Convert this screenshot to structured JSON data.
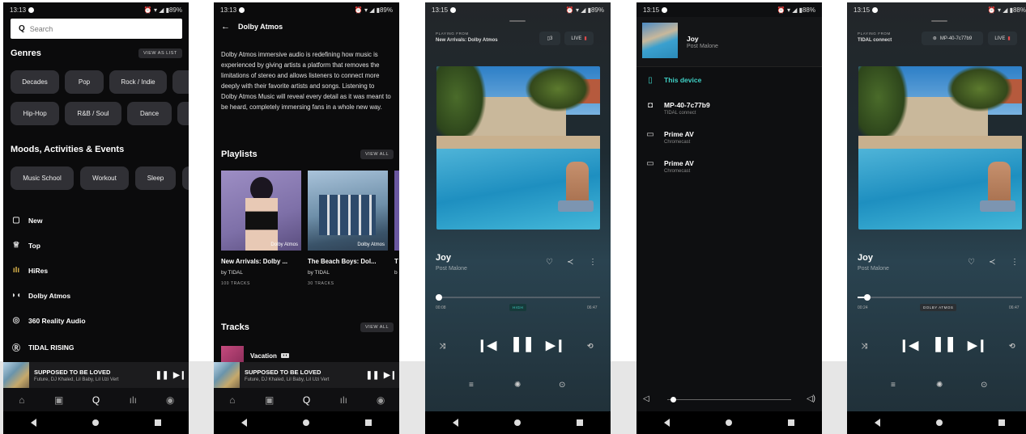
{
  "screens": {
    "search": {
      "status_time": "13:13",
      "status_icons": "⏰ ▾ ◢ ▮89%",
      "search_placeholder": "Search",
      "genres_title": "Genres",
      "view_as_list": "VIEW AS LIST",
      "genres": [
        "Decades",
        "Pop",
        "Rock / Indie",
        "Hip-Hop",
        "R&B / Soul",
        "Dance"
      ],
      "moods_title": "Moods, Activities & Events",
      "moods": [
        "Music School",
        "Workout",
        "Sleep"
      ],
      "menu": [
        {
          "label": "New",
          "icon": "calendar-icon"
        },
        {
          "label": "Top",
          "icon": "trophy-icon"
        },
        {
          "label": "HiRes",
          "icon": "waveform-icon"
        },
        {
          "label": "Dolby Atmos",
          "icon": "dolby-icon"
        },
        {
          "label": "360 Reality Audio",
          "icon": "360-icon"
        },
        {
          "label": "TIDAL RISING",
          "icon": "rising-icon"
        }
      ]
    },
    "dolby": {
      "status_time": "13:13",
      "status_icons": "⏰ ▾ ◢ ▮89%",
      "header": "Dolby Atmos",
      "description": "Dolby Atmos immersive audio is redefining how music is experienced by giving artists a platform that removes the limitations of stereo and allows listeners to connect more deeply with their favorite artists and songs. Listening to Dolby Atmos Music will reveal every detail as it was meant to be heard, completely immersing fans in a whole new way.",
      "playlists_title": "Playlists",
      "view_all": "VIEW ALL",
      "playlists": [
        {
          "title": "New Arrivals: Dolby ...",
          "by": "by TIDAL",
          "count": "100 TRACKS",
          "badge": "Dolby Atmos"
        },
        {
          "title": "The Beach Boys: Dol...",
          "by": "by TIDAL",
          "count": "30 TRACKS",
          "badge": "Dolby Atmos"
        },
        {
          "title": "T",
          "by": "b",
          "count": "",
          "badge": ""
        }
      ],
      "tracks_title": "Tracks",
      "track": "Vacation"
    },
    "mini_player": {
      "title": "SUPPOSED TO BE LOVED",
      "artists": "Future, DJ Khaled, Lil Baby, Lil Uzi Vert"
    },
    "player": {
      "status_time": "13:15",
      "status_icons": "⏰ ▾ ◢ ▮89%",
      "playing_from_label": "PLAYING FROM",
      "playing_from": "New Arrivals: Dolby Atmos",
      "queue_count": "3",
      "live": "LIVE",
      "song": "Joy",
      "artist": "Post Malone",
      "elapsed": "00:08",
      "duration": "06:47",
      "quality": "HIGH",
      "progress_fraction": 0.02
    },
    "devices": {
      "status_time": "13:15",
      "status_icons": "⏰ ▾ ◢ ▮88%",
      "song": "Joy",
      "artist": "Post Malone",
      "list": [
        {
          "name": "This device",
          "sub": "",
          "icon": "phone-icon",
          "active": true
        },
        {
          "name": "MP-40-7c77b9",
          "sub": "TIDAL connect",
          "icon": "speaker-icon",
          "active": false
        },
        {
          "name": "Prime AV",
          "sub": "Chromecast",
          "icon": "tv-icon",
          "active": false
        },
        {
          "name": "Prime AV",
          "sub": "Chromecast",
          "icon": "tv-icon",
          "active": false
        }
      ],
      "volume_fraction": 0.02
    },
    "connect": {
      "status_time": "13:15",
      "status_icons": "⏰ ▾ ◢ ▮88%",
      "playing_from_label": "PLAYING FROM",
      "playing_from": "TIDAL connect",
      "device": "MP-40-7c77b9",
      "live": "LIVE",
      "song": "Joy",
      "artist": "Post Malone",
      "elapsed": "00:24",
      "duration": "06:47",
      "quality": "DOLBY ATMOS",
      "progress_fraction": 0.06
    }
  },
  "colors": {
    "accent_teal": "#3fd1c6",
    "background": "#0b0b0c"
  }
}
